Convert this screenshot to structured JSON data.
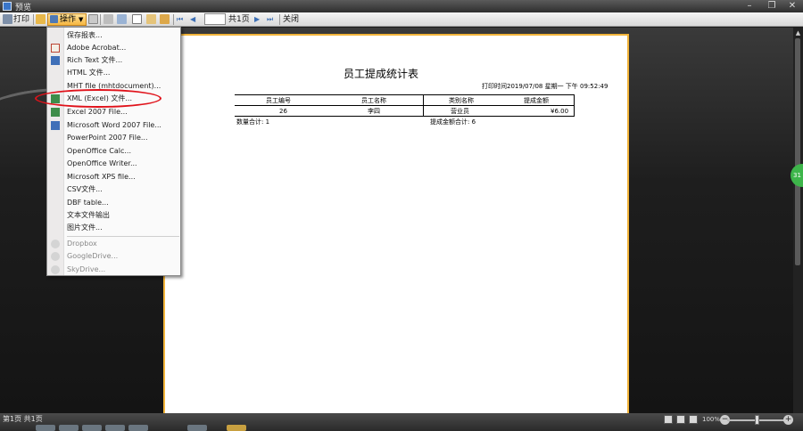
{
  "window": {
    "title": "预览",
    "minimize": "–",
    "restore": "❐",
    "close": "✕"
  },
  "toolbar": {
    "print_label": "打印",
    "export_label": "操作",
    "page_input_value": "",
    "total_pages": "共1页",
    "close_label": "关闭"
  },
  "export_menu": {
    "items": [
      {
        "label": "保存报表...",
        "enabled": true
      },
      {
        "label": "Adobe Acrobat...",
        "enabled": true
      },
      {
        "label": "Rich Text 文件...",
        "enabled": true
      },
      {
        "label": "HTML 文件...",
        "enabled": true
      },
      {
        "label": "MHT file (mhtdocument)...",
        "enabled": true
      },
      {
        "label": "XML (Excel) 文件...",
        "enabled": true,
        "highlighted": true
      },
      {
        "label": "Excel 2007 File...",
        "enabled": true
      },
      {
        "label": "Microsoft Word 2007 File...",
        "enabled": true
      },
      {
        "label": "PowerPoint 2007 File...",
        "enabled": true
      },
      {
        "label": "OpenOffice Calc...",
        "enabled": true
      },
      {
        "label": "OpenOffice Writer...",
        "enabled": true
      },
      {
        "label": "Microsoft XPS file...",
        "enabled": true
      },
      {
        "label": "CSV文件...",
        "enabled": true
      },
      {
        "label": "DBF table...",
        "enabled": true
      },
      {
        "label": "文本文件输出",
        "enabled": true
      },
      {
        "label": "图片文件...",
        "enabled": true
      },
      {
        "label": "Dropbox",
        "enabled": false
      },
      {
        "label": "GoogleDrive...",
        "enabled": false
      },
      {
        "label": "SkyDrive...",
        "enabled": false
      }
    ]
  },
  "report": {
    "title": "员工提成统计表",
    "print_time": "打印时间2019/07/08 星期一 下午 09:52:49",
    "columns": [
      "员工编号",
      "员工名称",
      "类别名称",
      "提成金额"
    ],
    "rows": [
      [
        "26",
        "李四",
        "营业员",
        "¥6.00"
      ]
    ],
    "summary_count": "数量合计: 1",
    "summary_amount": "提成金额合计: 6"
  },
  "statusbar": {
    "page_status": "第1页 共1页",
    "zoom": "100%",
    "zoom_out": "−",
    "zoom_in": "+"
  },
  "side_badge": "31",
  "colors": {
    "highlight_ellipse": "#e0121a",
    "paper_border": "#f2b43a",
    "export_button": "#f6b640"
  }
}
